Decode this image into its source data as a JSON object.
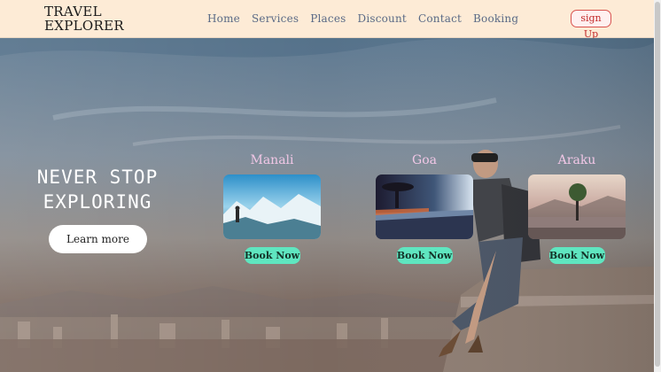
{
  "brand": {
    "line1": "TRAVEL",
    "line2": "EXPLORER"
  },
  "nav": [
    "Home",
    "Services",
    "Places",
    "Discount",
    "Contact",
    "Booking"
  ],
  "signup_label": "sign Up",
  "hero": {
    "tagline_line1": "NEVER STOP",
    "tagline_line2": "EXPLORING",
    "cta_label": "Learn more"
  },
  "destinations": [
    {
      "name": "Manali",
      "button": "Book Now"
    },
    {
      "name": "Goa",
      "button": "Book Now"
    },
    {
      "name": "Araku",
      "button": "Book Now"
    }
  ],
  "colors": {
    "header_bg": "#fdebd6",
    "nav_text": "#5a6a86",
    "signup_border": "#d9534f",
    "book_button": "#5fe6c0",
    "card_title": "#f1c7e6"
  }
}
